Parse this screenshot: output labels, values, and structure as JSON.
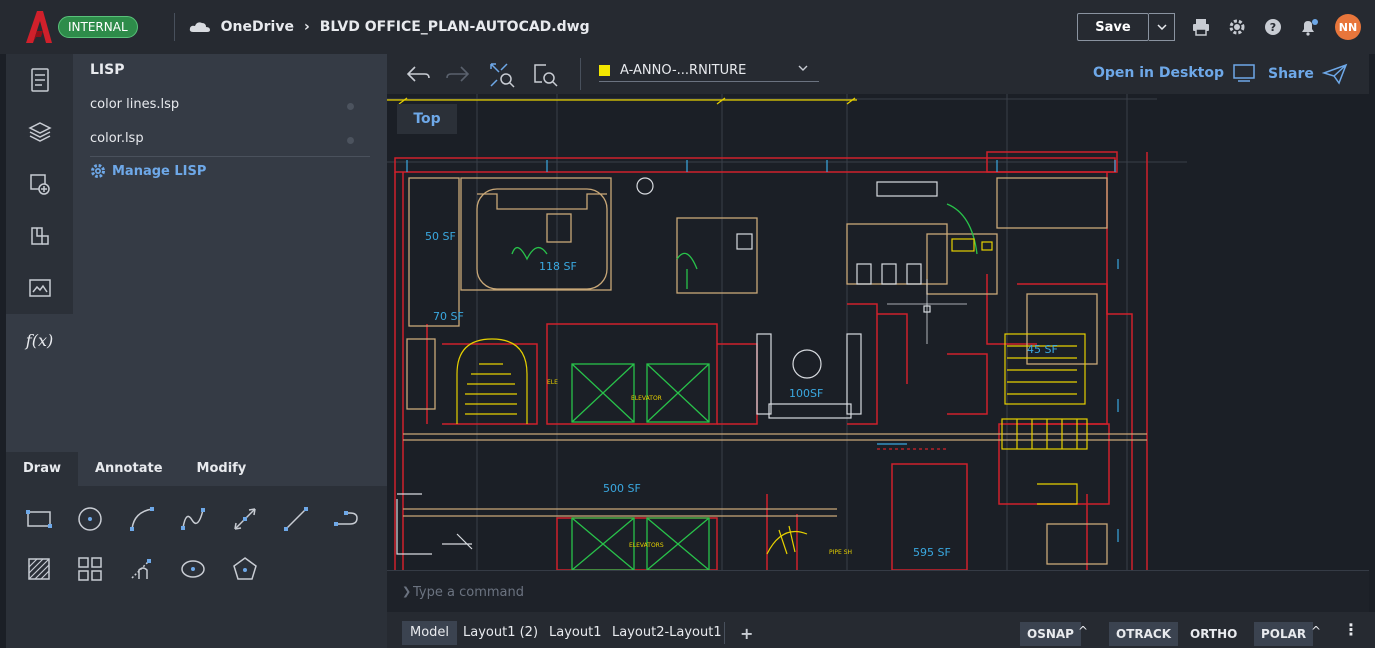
{
  "header": {
    "badge": "INTERNAL",
    "crumb_root": "OneDrive",
    "crumb_sep": "›",
    "file_name": "BLVD OFFICE_PLAN-AUTOCAD.dwg",
    "save_label": "Save",
    "avatar_initials": "NN"
  },
  "lisp_panel": {
    "title": "LISP",
    "items": [
      {
        "label": "color lines.lsp"
      },
      {
        "label": "color.lsp"
      }
    ],
    "manage_label": "Manage LISP"
  },
  "rail": {
    "fx_label": "f(x)"
  },
  "toolbox": {
    "tabs": [
      "Draw",
      "Annotate",
      "Modify"
    ]
  },
  "canvas_toolbar": {
    "layer_name": "A-ANNO-...RNITURE",
    "layer_color": "#f2e600",
    "open_desktop_label": "Open in Desktop",
    "share_label": "Share"
  },
  "viewport": {
    "view_label": "Top",
    "room_labels": [
      "50 SF",
      "118 SF",
      "70 SF",
      "45 SF",
      "100SF",
      "500 SF",
      "595 SF"
    ],
    "small_labels": [
      "ELEVATOR",
      "ELEVATORS",
      "PIPE SH",
      "ELE"
    ]
  },
  "command": {
    "placeholder": "Type a command"
  },
  "layout_tabs": [
    "Model",
    "Layout1 (2)",
    "Layout1",
    "Layout2-Layout1"
  ],
  "status": {
    "osnap": "OSNAP",
    "otrack": "OTRACK",
    "ortho": "ORTHO",
    "polar": "POLAR"
  },
  "colors": {
    "accent_blue": "#6ea8e8",
    "badge_green": "#2e8c4a",
    "logo_red": "#d0202b"
  }
}
